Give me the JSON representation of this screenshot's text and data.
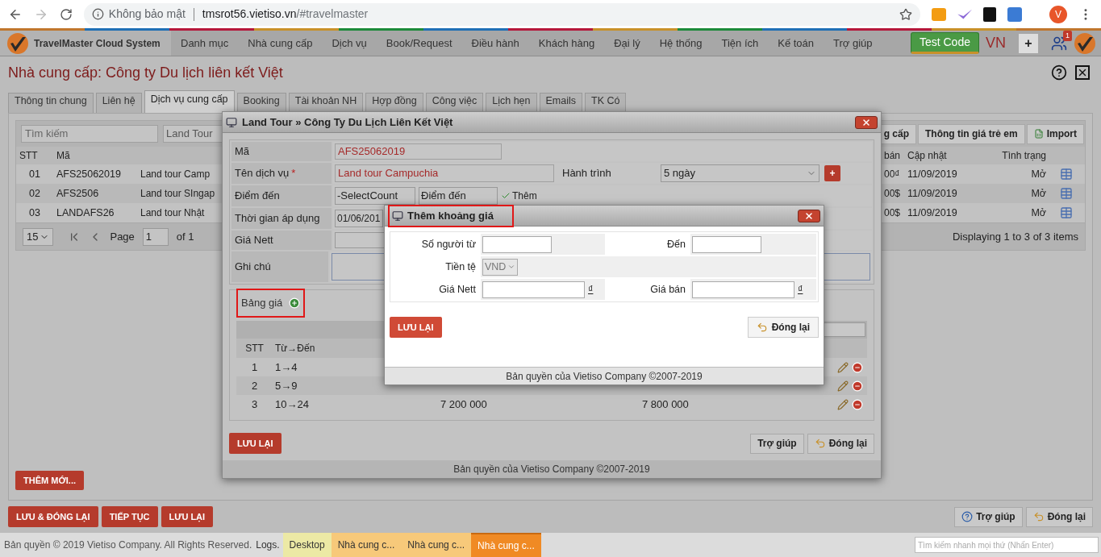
{
  "browser": {
    "security": "Không bảo mật",
    "host": "tmsrot56.vietiso.vn",
    "path": "/#travelmaster",
    "avatar": "V"
  },
  "app": {
    "name": "TravelMaster Cloud System",
    "menu": [
      "Danh mục",
      "Nhà cung cấp",
      "Dịch vụ",
      "Book/Request",
      "Điều hành",
      "Khách hàng",
      "Đại lý",
      "Hệ thống",
      "Tiện ích",
      "Kế toán",
      "Trợ giúp"
    ],
    "test_button": "Test Code",
    "language": "VN",
    "add_button": "+",
    "notifications": "1"
  },
  "page_title": "Nhà cung cấp: Công ty Du lịch liên kết Việt",
  "tabs": [
    {
      "label": "Thông tin chung",
      "selected": false
    },
    {
      "label": "Liên hệ",
      "selected": false
    },
    {
      "label": "Dịch vụ cung cấp",
      "selected": true
    },
    {
      "label": "Booking",
      "selected": false
    },
    {
      "label": "Tài khoản NH",
      "selected": false
    },
    {
      "label": "Hợp đồng",
      "selected": false
    },
    {
      "label": "Công việc",
      "selected": false
    },
    {
      "label": "Lịch hẹn",
      "selected": false
    },
    {
      "label": "Emails",
      "selected": false
    },
    {
      "label": "TK Có",
      "selected": false
    }
  ],
  "list": {
    "search_placeholder": "Tìm kiếm",
    "type_filter": "Land Tour",
    "toolbar_buttons": [
      "g cấp",
      "Thông tin giá trẻ em",
      "Import"
    ],
    "columns_left": [
      "STT",
      "Mã"
    ],
    "columns_right": [
      "bán",
      "Cập nhật",
      "Tình trạng"
    ],
    "rows": [
      {
        "stt": "01",
        "code": "AFS25062019",
        "name": "Land tour Camp",
        "price": "00₫",
        "updated": "11/09/2019",
        "status": "Mở"
      },
      {
        "stt": "02",
        "code": "AFS2506",
        "name": "Land tour SIngap",
        "price": "00$",
        "updated": "11/09/2019",
        "status": "Mở"
      },
      {
        "stt": "03",
        "code": "LANDAFS26",
        "name": "Land tour Nhật",
        "price": "00$",
        "updated": "11/09/2019",
        "status": "Mở"
      }
    ],
    "page_size": "15",
    "page_label": "Page",
    "page": "1",
    "page_of": "of 1",
    "summary": "Displaying 1 to 3 of 3 items"
  },
  "add_new": "THÊM MỚI...",
  "actions_left": [
    "LƯU & ĐÓNG LẠI",
    "TIẾP TỤC",
    "LƯU LẠI"
  ],
  "actions_right": [
    "Trợ giúp",
    "Đóng lại"
  ],
  "status_bar": {
    "copyright": "Bản quyền © 2019 Vietiso Company. All Rights Reserved.",
    "logs": "Logs.",
    "tasks": [
      {
        "label": "Desktop",
        "color": "#ece9a5",
        "selected": false
      },
      {
        "label": "Nhà cung c...",
        "color": "#f7c97a",
        "selected": false
      },
      {
        "label": "Nhà cung c...",
        "color": "#f7c97a",
        "selected": false
      },
      {
        "label": "Nhà cung c...",
        "color": "#f08a24",
        "selected": true
      }
    ],
    "search_placeholder": "Tìm kiếm nhanh mọi thứ (Nhấn Enter)"
  },
  "service_dialog": {
    "title": "Land Tour » Công Ty Du Lịch Liên Kết Việt",
    "code_label": "Mã",
    "code": "AFS25062019",
    "name_label": "Tên dịch vụ",
    "required_mark": "*",
    "name": "Land tour Campuchia",
    "itinerary_label": "Hành trình",
    "itinerary": "5 ngày",
    "add_itinerary": "+",
    "destination_label": "Điểm đến",
    "country": "-SelectCount",
    "destination": "Điểm đến",
    "add_destination": "Thêm",
    "period_label": "Thời gian áp dụng",
    "period_from": "01/06/201",
    "nett_label": "Giá Nett",
    "note_label": "Ghi chú",
    "price_table_label": "Bảng giá",
    "price_columns": [
      "STT",
      "Từ→Đến"
    ],
    "price_rows": [
      {
        "stt": "1",
        "range": "1→4"
      },
      {
        "stt": "2",
        "range": "5→9"
      },
      {
        "stt": "3",
        "range": "10→24",
        "nett": "7 200 000",
        "sell": "7 800 000"
      }
    ],
    "save": "LƯU LẠI",
    "help": "Trợ giúp",
    "close": "Đóng lại",
    "footer": "Bản quyền của Vietiso Company ©2007-2019"
  },
  "price_dialog": {
    "title": "Thêm khoảng giá",
    "from_label": "Số người từ",
    "to_label": "Đến",
    "currency_label": "Tiền tệ",
    "currency": "VND",
    "nett_label": "Giá Nett",
    "sell_label": "Giá bán",
    "currency_symbol": "₫",
    "save": "LƯU LẠI",
    "close": "Đóng lại",
    "footer": "Bản quyền của Vietiso Company ©2007-2019"
  }
}
